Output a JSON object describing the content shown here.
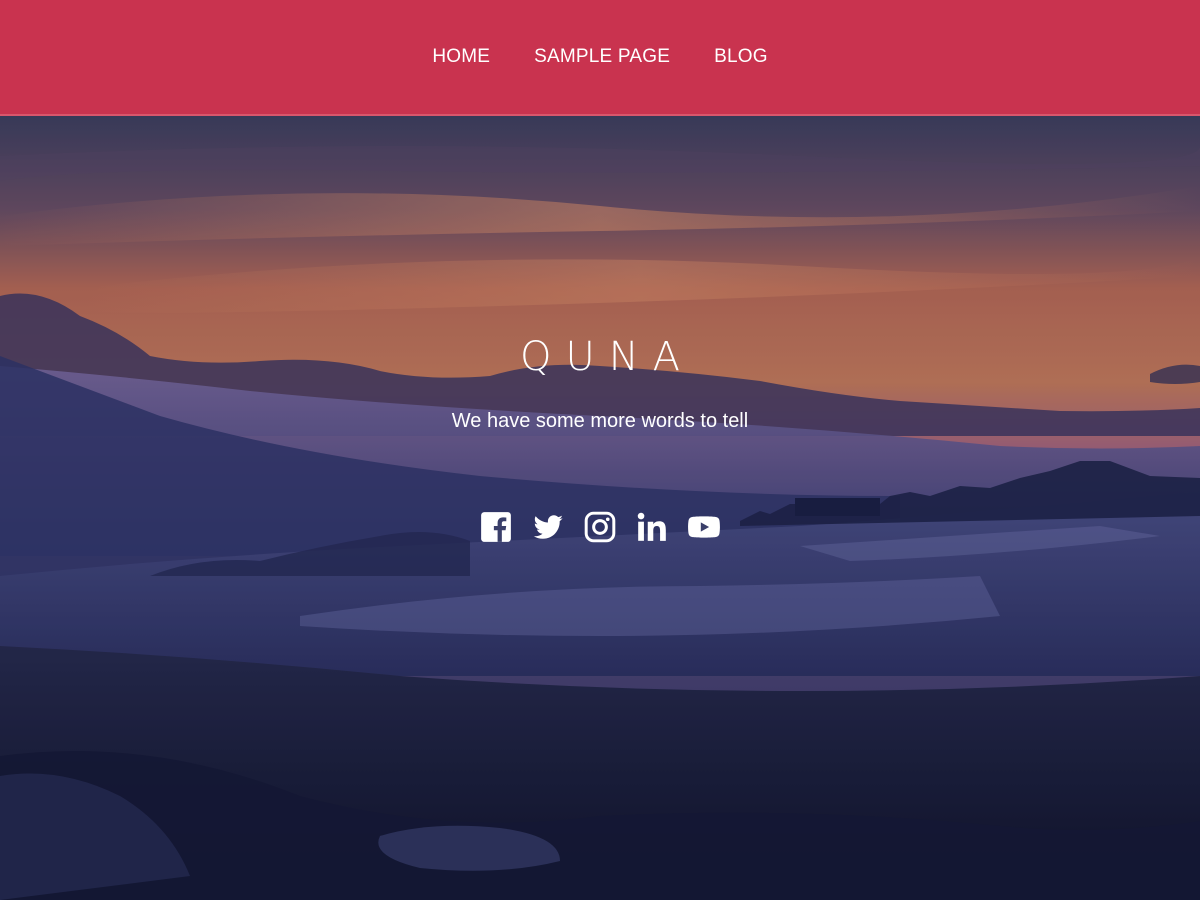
{
  "nav": {
    "items": [
      {
        "label": "HOME"
      },
      {
        "label": "SAMPLE PAGE"
      },
      {
        "label": "BLOG"
      }
    ]
  },
  "hero": {
    "title": "QUNA",
    "tagline": "We have some more words to tell"
  },
  "social": [
    {
      "icon": "facebook-icon"
    },
    {
      "icon": "twitter-icon"
    },
    {
      "icon": "instagram-icon"
    },
    {
      "icon": "linkedin-icon"
    },
    {
      "icon": "youtube-icon"
    }
  ],
  "colors": {
    "header_bg": "#c9334f",
    "text": "#ffffff"
  }
}
